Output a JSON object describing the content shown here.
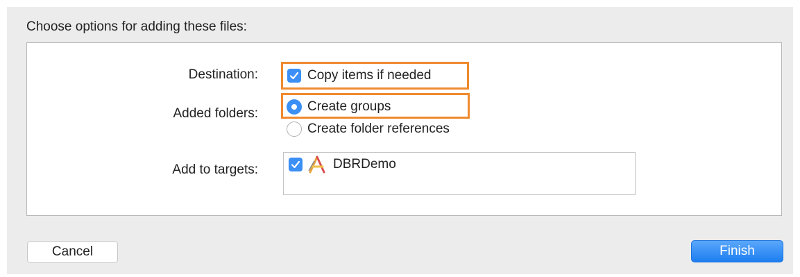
{
  "dialog": {
    "heading": "Choose options for adding these files:",
    "destination": {
      "label": "Destination:",
      "option": "Copy items if needed",
      "checked": true
    },
    "added_folders": {
      "label": "Added folders:",
      "options": [
        {
          "label": "Create groups",
          "selected": true
        },
        {
          "label": "Create folder references",
          "selected": false
        }
      ]
    },
    "targets": {
      "label": "Add to targets:",
      "items": [
        {
          "name": "DBRDemo",
          "checked": true,
          "icon": "app-target-icon"
        }
      ]
    },
    "buttons": {
      "cancel": "Cancel",
      "finish": "Finish"
    }
  },
  "colors": {
    "accent": "#3b8ff5",
    "highlight": "#ef8a2f",
    "background": "#ececec"
  }
}
